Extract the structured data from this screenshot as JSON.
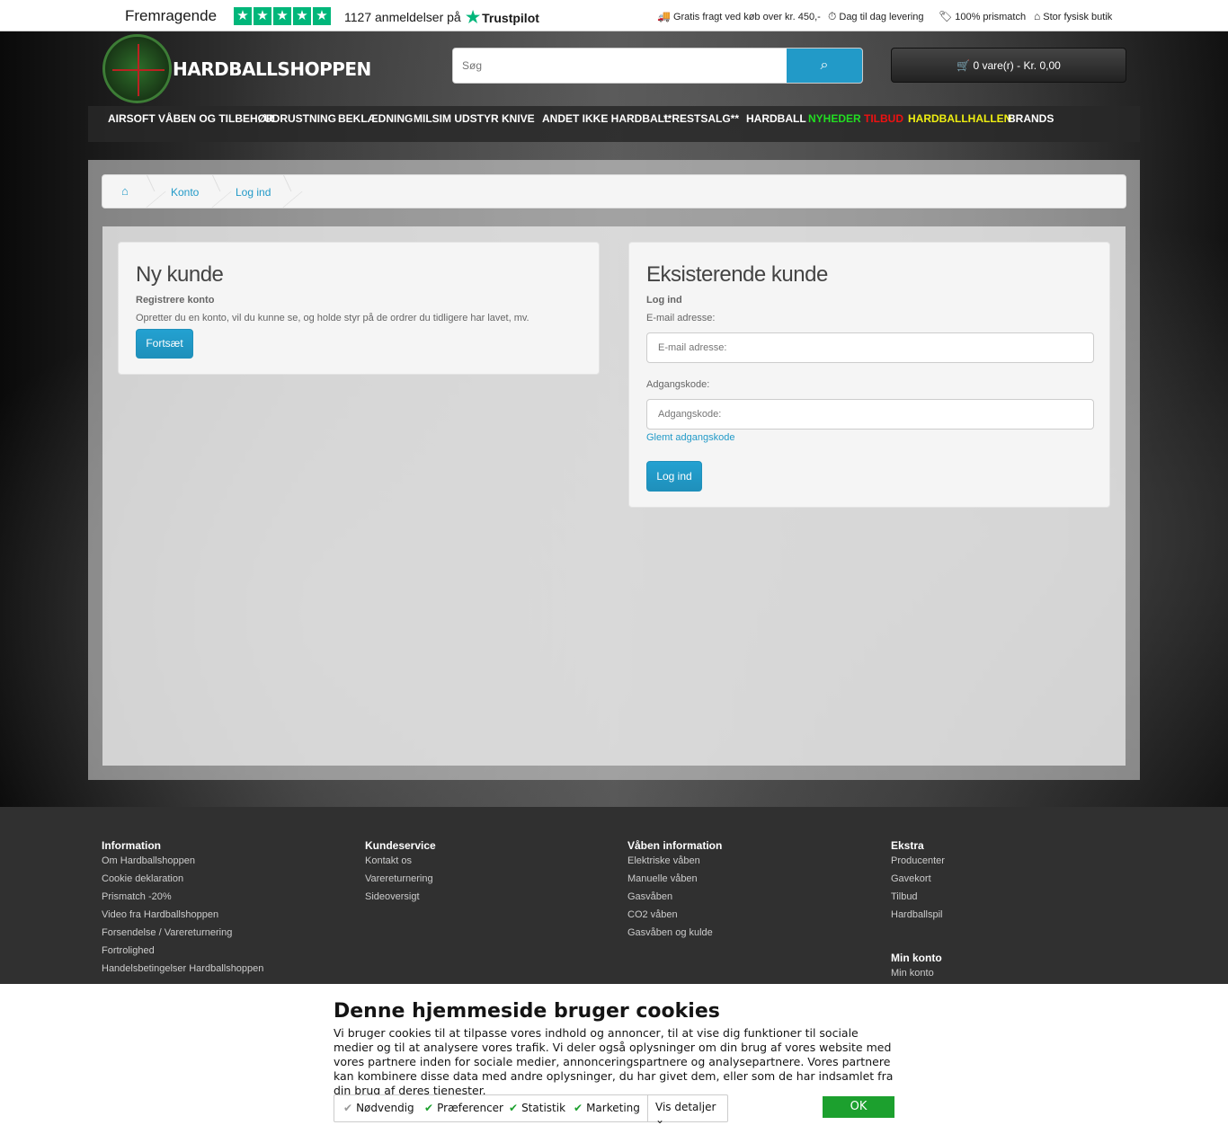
{
  "trustbar": {
    "rating_label": "Fremragende",
    "reviews_text": "1127 anmeldelser på",
    "trustpilot_label": "Trustpilot",
    "usps": [
      {
        "icon": "truck-icon",
        "text": "Gratis fragt ved køb over kr. 450,-"
      },
      {
        "icon": "clock-icon",
        "text": "Dag til dag levering"
      },
      {
        "icon": "tag-icon",
        "text": "100% prismatch"
      },
      {
        "icon": "home-icon",
        "text": "Stor fysisk butik"
      }
    ]
  },
  "header": {
    "logo_text": "HARDBALLSHOPPEN",
    "search_placeholder": "Søg",
    "cart_text": "0 vare(r) - Kr. 0,00"
  },
  "nav": {
    "items": [
      {
        "label": "AIRSOFT VÅBEN OG TILBEHØR",
        "color": "#ffffff"
      },
      {
        "label": "UDRUSTNING",
        "color": "#ffffff"
      },
      {
        "label": "BEKLÆDNING",
        "color": "#ffffff"
      },
      {
        "label": "MILSIM UDSTYR",
        "color": "#ffffff"
      },
      {
        "label": "KNIVE",
        "color": "#ffffff"
      },
      {
        "label": "ANDET IKKE HARDBALL",
        "color": "#ffffff"
      },
      {
        "label": "**RESTSALG**",
        "color": "#ffffff"
      },
      {
        "label": "HARDBALL",
        "color": "#ffffff"
      },
      {
        "label": "NYHEDER",
        "color": "#22dd22"
      },
      {
        "label": "TILBUD",
        "color": "#ee1111"
      },
      {
        "label": "HARDBALLHALLEN",
        "color": "#eeee11"
      },
      {
        "label": "BRANDS",
        "color": "#ffffff"
      }
    ]
  },
  "breadcrumb": {
    "items": [
      "Konto",
      "Log ind"
    ]
  },
  "new_customer": {
    "title": "Ny kunde",
    "subtitle": "Registrere konto",
    "text": "Opretter du en konto, vil du kunne se, og holde styr på de ordrer du tidligere har lavet, mv.",
    "button": "Fortsæt"
  },
  "existing_customer": {
    "title": "Eksisterende kunde",
    "subtitle": "Log ind",
    "email_label": "E-mail adresse:",
    "email_placeholder": "E-mail adresse:",
    "password_label": "Adgangskode:",
    "password_placeholder": "Adgangskode:",
    "forgot_link": "Glemt adgangskode",
    "login_button": "Log ind"
  },
  "footer": {
    "columns": [
      {
        "heading": "Information",
        "links": [
          "Om Hardballshoppen",
          "Cookie deklaration",
          "Prismatch -20%",
          "Video fra Hardballshoppen",
          "Forsendelse / Varereturnering",
          "Fortrolighed",
          "Handelsbetingelser Hardballshoppen"
        ]
      },
      {
        "heading": "Kundeservice",
        "links": [
          "Kontakt os",
          "Varereturnering",
          "Sideoversigt"
        ]
      },
      {
        "heading": "Våben information",
        "links": [
          "Elektriske våben",
          "Manuelle våben",
          "Gasvåben",
          "CO2 våben",
          "Gasvåben og kulde"
        ]
      },
      {
        "heading": "Ekstra",
        "links": [
          "Producenter",
          "Gavekort",
          "Tilbud",
          "Hardballspil"
        ]
      }
    ],
    "account_heading": "Min konto",
    "account_links": [
      "Min konto"
    ]
  },
  "cookie": {
    "title": "Denne hjemmeside bruger cookies",
    "text": "Vi bruger cookies til at tilpasse vores indhold og annoncer, til at vise dig funktioner til sociale medier og til at analysere vores trafik. Vi deler også oplysninger om din brug af vores website med vores partnere inden for sociale medier, annonceringspartnere og analysepartnere. Vores partnere kan kombinere disse data med andre oplysninger, du har givet dem, eller som de har indsamlet fra din brug af deres tjenester.",
    "options": [
      "Nødvendig",
      "Præferencer",
      "Statistik",
      "Marketing"
    ],
    "details": "Vis detaljer",
    "ok": "OK"
  }
}
